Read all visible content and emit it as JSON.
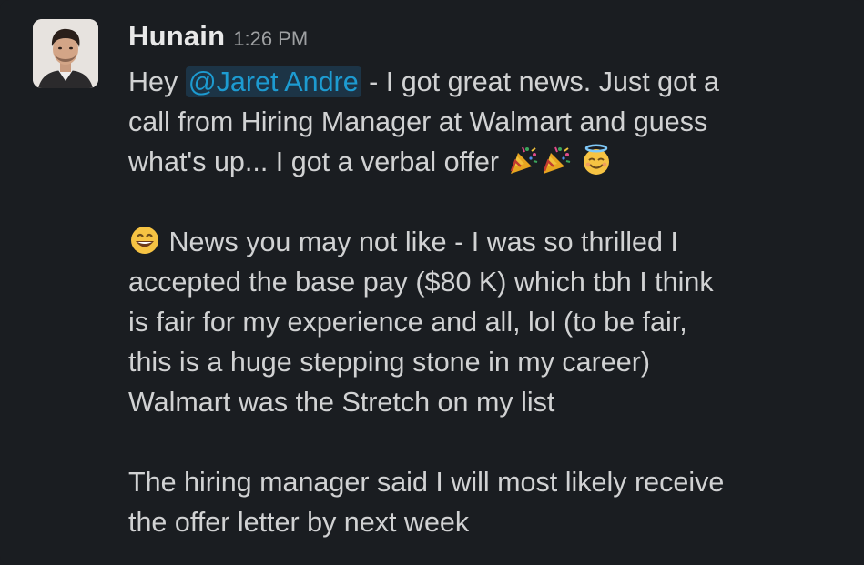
{
  "message": {
    "author": "Hunain",
    "time": "1:26 PM",
    "avatar_icon": "user-avatar-photo",
    "paragraph1": {
      "line1_before": "Hey ",
      "mention": "@Jaret Andre",
      "line1_after": " - I got great news. Just got a",
      "line2": "call from Hiring Manager at Walmart and guess",
      "line3": "what's up... I got a verbal offer",
      "emojis": [
        "party-popper-emoji",
        "party-popper-emoji",
        "smiling-face-with-halo-emoji"
      ]
    },
    "paragraph2": {
      "emoji": "grinning-face-emoji",
      "line1": "News you may not like - I was so thrilled I",
      "line2": "accepted the base pay ($80 K) which tbh I think",
      "line3": "is fair for my experience and all, lol (to be fair,",
      "line4": "this is a huge stepping stone in my career)",
      "line5": "Walmart was the Stretch on my list"
    },
    "paragraph3": {
      "line1": "The hiring manager said I will most likely receive",
      "line2": "the offer letter by next week"
    }
  },
  "colors": {
    "background": "#1a1d21",
    "text": "#d1d2d3",
    "author": "#e8e8e8",
    "timestamp": "#9ea0a2",
    "mention_text": "#1d9bd1",
    "mention_bg": "#1c3446"
  }
}
